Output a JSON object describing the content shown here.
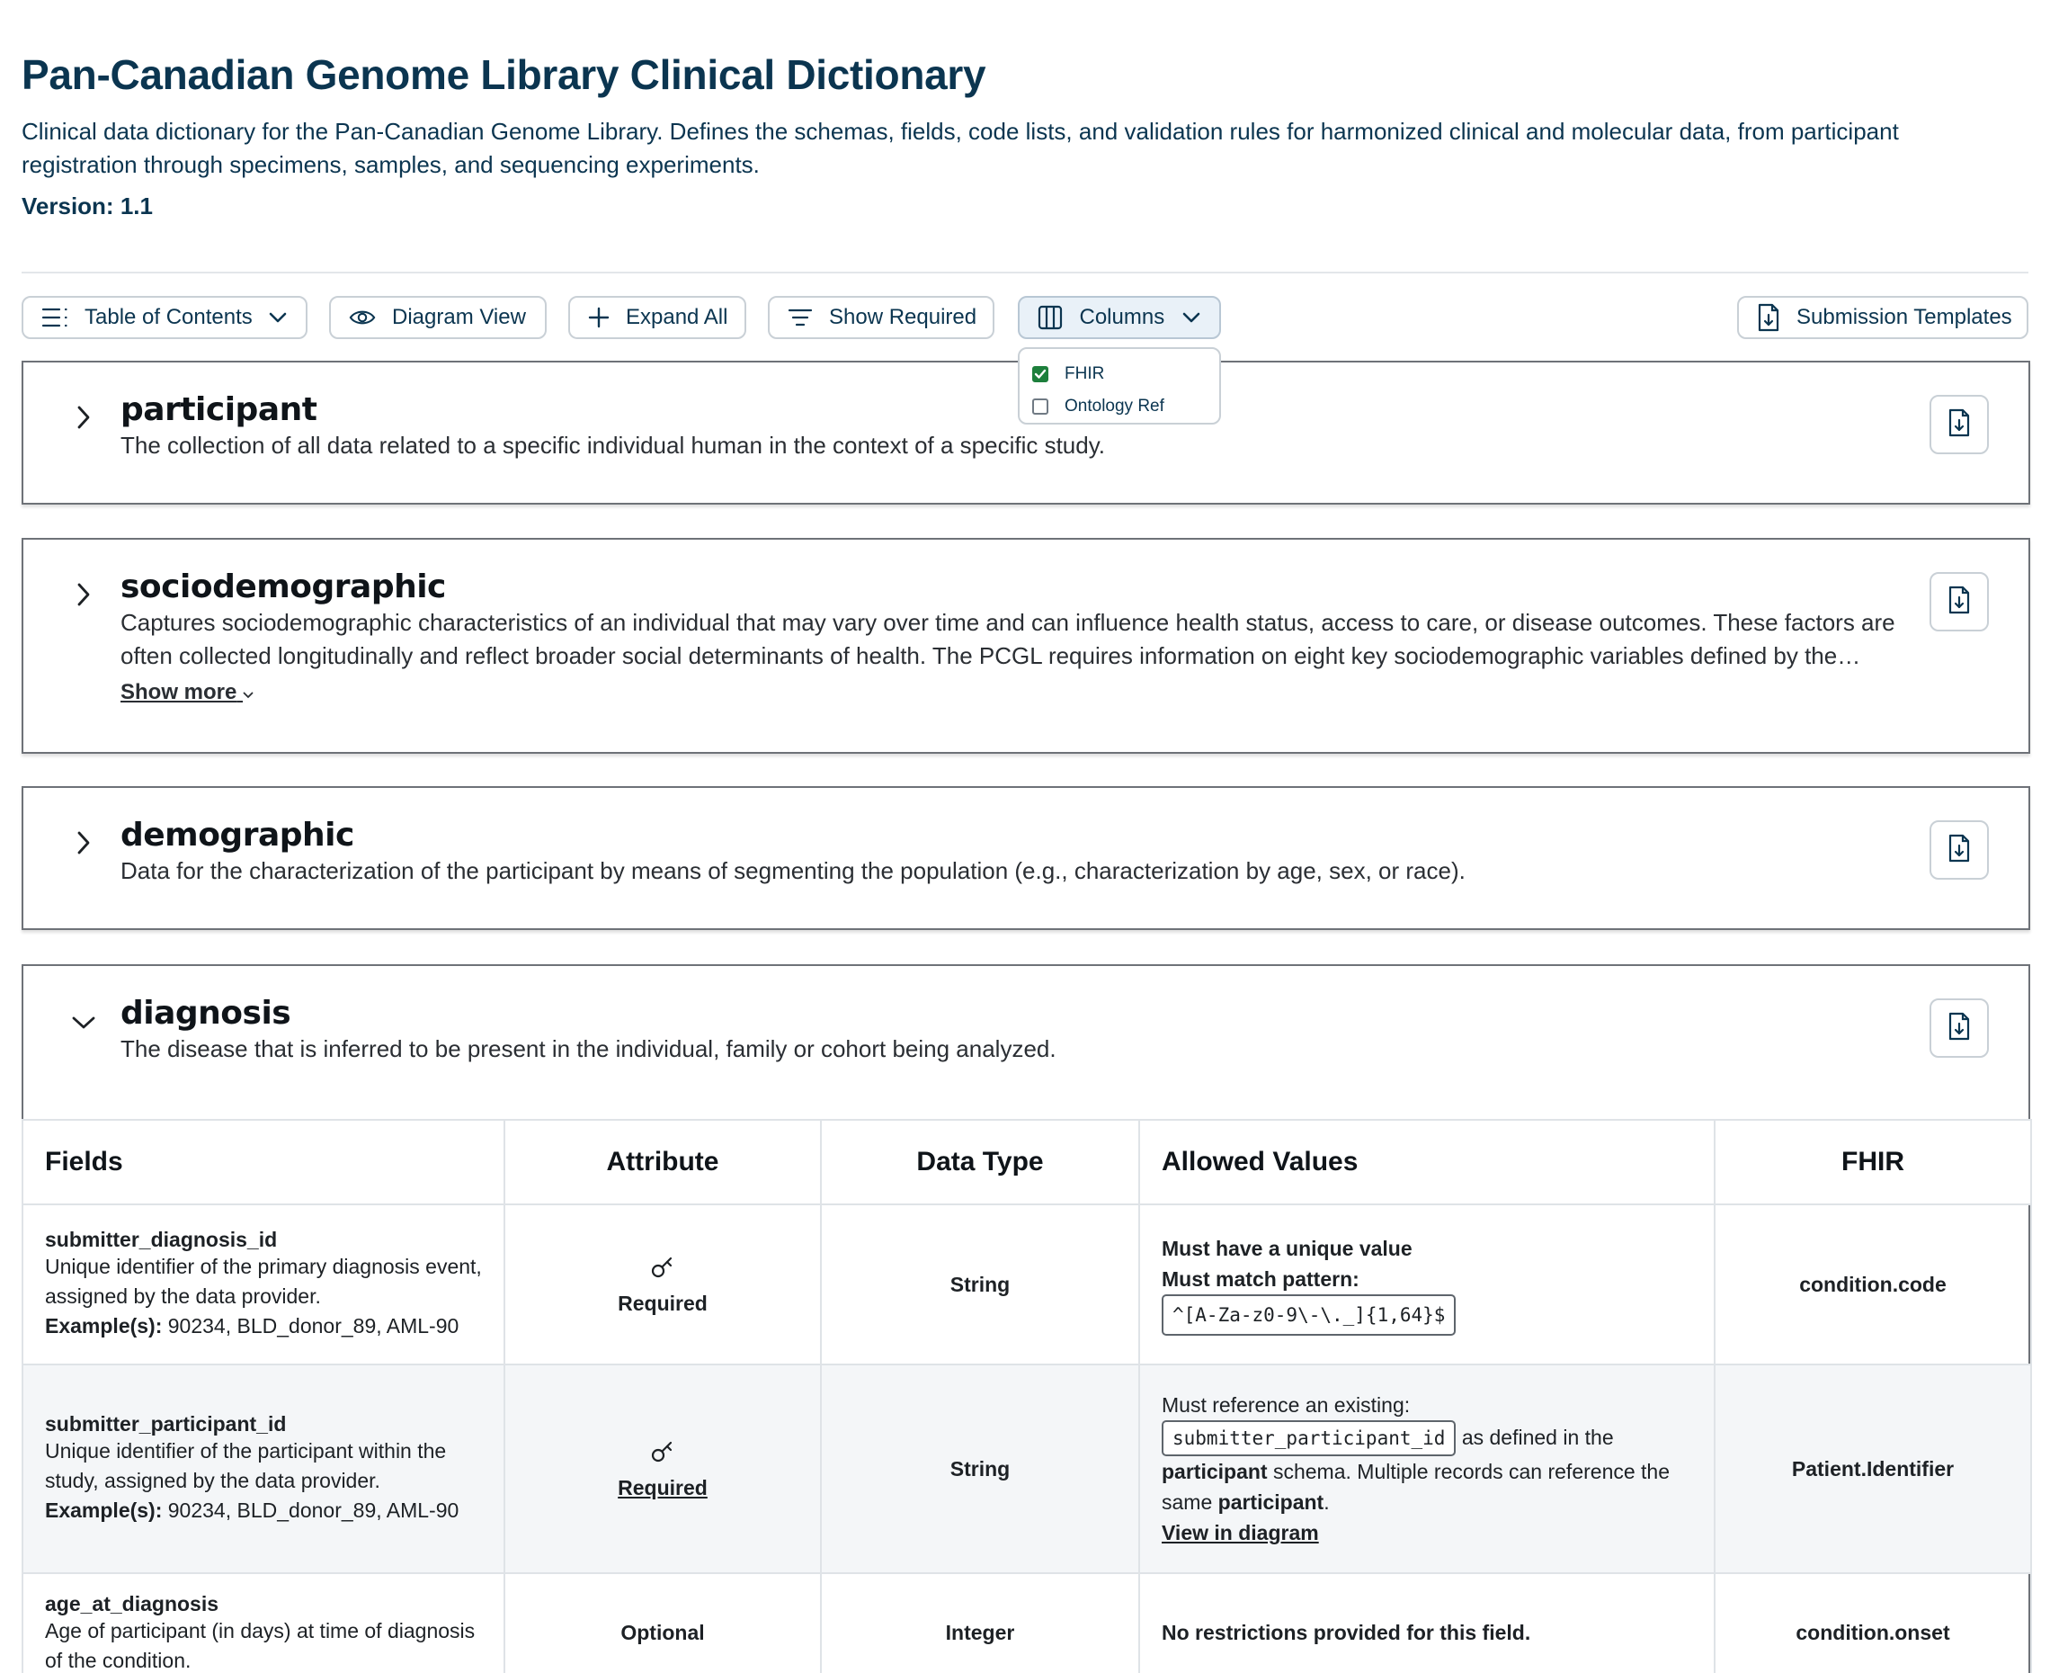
{
  "header": {
    "title": "Pan-Canadian Genome Library Clinical Dictionary",
    "description": "Clinical data dictionary for the Pan-Canadian Genome Library. Defines the schemas, fields, code lists, and validation rules for harmonized clinical and molecular data, from participant registration through specimens, samples, and sequencing experiments.",
    "version_label": "Version: 1.1"
  },
  "toolbar": {
    "toc_label": "Table of Contents",
    "diagram_label": "Diagram View",
    "expand_label": "Expand All",
    "required_label": "Show Required",
    "columns_label": "Columns",
    "templates_label": "Submission Templates"
  },
  "columns_menu": {
    "items": [
      {
        "label": "FHIR",
        "checked": true
      },
      {
        "label": "Ontology Ref",
        "checked": false
      }
    ]
  },
  "schemas": [
    {
      "name": "participant",
      "description": "The collection of all data related to a specific individual human in the context of a specific study.",
      "expanded": false
    },
    {
      "name": "sociodemographic",
      "description": "Captures sociodemographic characteristics of an individual that may vary over time and can influence health status, access to care, or disease outcomes. These factors are often collected longitudinally and reflect broader social determinants of health. The PCGL requires information on eight key sociodemographic variables defined by the…",
      "show_more": "Show more",
      "expanded": false
    },
    {
      "name": "demographic",
      "description": "Data for the characterization of the participant by means of segmenting the population (e.g., characterization by age, sex, or race).",
      "expanded": false
    },
    {
      "name": "diagnosis",
      "description": "The disease that is inferred to be present in the individual, family or cohort being analyzed.",
      "expanded": true
    }
  ],
  "table": {
    "headers": [
      "Fields",
      "Attribute",
      "Data Type",
      "Allowed Values",
      "FHIR"
    ],
    "rows": [
      {
        "name": "submitter_diagnosis_id",
        "description": "Unique identifier of the primary diagnosis event, assigned by the data provider.",
        "example_label": "Example(s):",
        "examples": "90234, BLD_donor_89, AML-90",
        "attribute": "Required",
        "data_type": "String",
        "allowed_line1": "Must have a unique value",
        "allowed_line2": "Must match pattern:",
        "pattern": "^[A-Za-z0-9\\-\\._]{1,64}$",
        "fhir": "condition.code"
      },
      {
        "name": "submitter_participant_id",
        "description": "Unique identifier of the participant within the study, assigned by the data provider.",
        "example_label": "Example(s):",
        "examples": "90234, BLD_donor_89, AML-90",
        "attribute": "Required",
        "data_type": "String",
        "allowed_intro": "Must reference an existing:",
        "allowed_ref": "submitter_participant_id",
        "allowed_as": "as defined in the",
        "allowed_schema": "participant",
        "allowed_rest": "schema. Multiple records can reference the same",
        "allowed_schema2": "participant",
        "view_diagram": "View in diagram",
        "fhir": "Patient.Identifier"
      },
      {
        "name": "age_at_diagnosis",
        "description": "Age of participant (in days) at time of diagnosis of the condition.",
        "attribute": "Optional",
        "data_type": "Integer",
        "allowed_line1": "No restrictions provided for this field.",
        "fhir": "condition.onset"
      }
    ]
  }
}
